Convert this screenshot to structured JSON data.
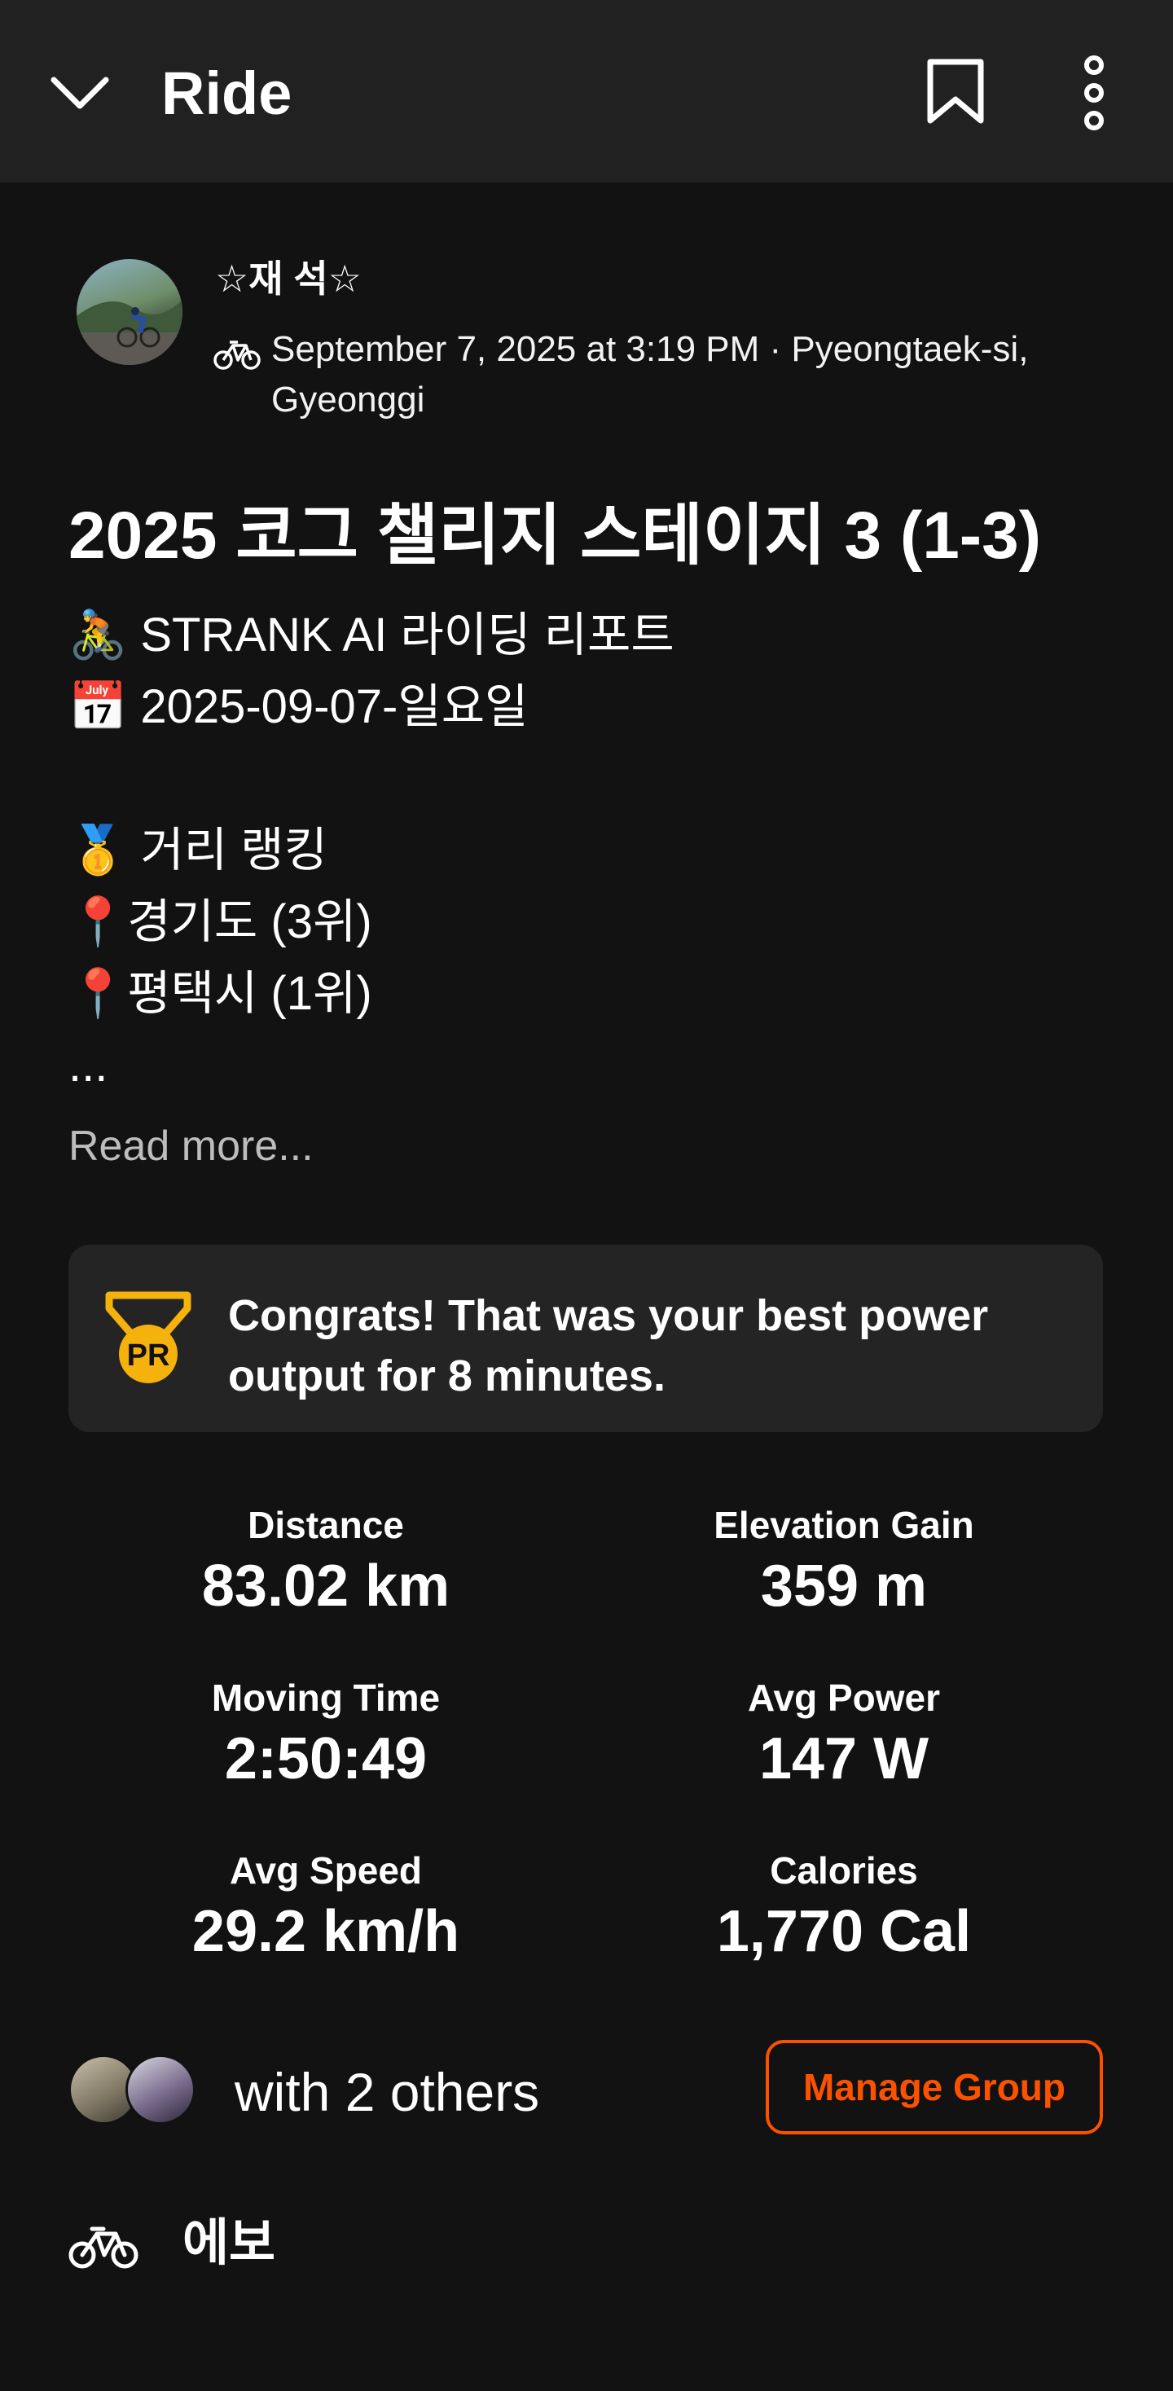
{
  "header": {
    "title": "Ride",
    "back_icon": "chevron-down-icon",
    "bookmark_icon": "bookmark-icon",
    "more_icon": "more-vertical-icon"
  },
  "athlete": {
    "name": "☆재 석☆",
    "activity_type_icon": "bike-icon",
    "date_location": "September 7, 2025 at 3:19 PM · Pyeongtaek-si, Gyeonggi"
  },
  "activity": {
    "title": "2025 코그 챌리지 스테이지 3 (1-3)",
    "description_lines": [
      "🚴 STRANK AI 라이딩 리포트",
      "📅 2025-09-07-일요일",
      "",
      "🥇 거리 랭킹",
      "📍경기도 (3위)",
      "📍평택시 (1위)",
      "..."
    ],
    "read_more": "Read more..."
  },
  "pr_card": {
    "badge_text": "PR",
    "message": "Congrats! That was your best power output for 8 minutes.",
    "accent_color": "#f5b10c"
  },
  "stats": [
    {
      "label": "Distance",
      "value": "83.02 km"
    },
    {
      "label": "Elevation Gain",
      "value": "359 m"
    },
    {
      "label": "Moving Time",
      "value": "2:50:49"
    },
    {
      "label": "Avg Power",
      "value": "147 W"
    },
    {
      "label": "Avg Speed",
      "value": "29.2 km/h"
    },
    {
      "label": "Calories",
      "value": "1,770 Cal"
    }
  ],
  "group": {
    "text": "with 2 others",
    "button_label": "Manage Group",
    "button_color": "#fc5200"
  },
  "gear": {
    "icon": "bike-icon",
    "name": "에보"
  }
}
